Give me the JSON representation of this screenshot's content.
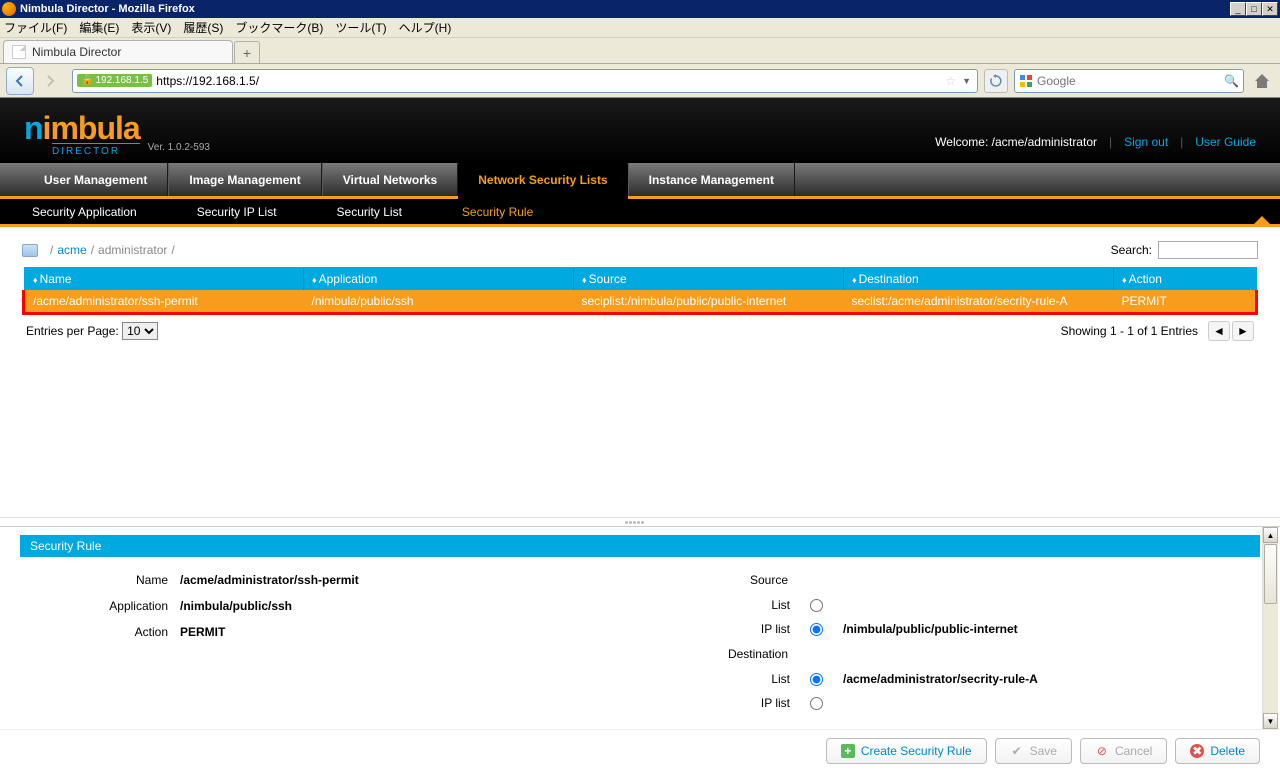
{
  "window": {
    "title": "Nimbula Director - Mozilla Firefox"
  },
  "menubar": {
    "file": "ファイル(F)",
    "edit": "編集(E)",
    "view": "表示(V)",
    "history": "履歴(S)",
    "bookmarks": "ブックマーク(B)",
    "tools": "ツール(T)",
    "help": "ヘルプ(H)"
  },
  "tabs": {
    "title": "Nimbula Director"
  },
  "nav": {
    "badge": "192.168.1.5",
    "url": "https://192.168.1.5/",
    "search_placeholder": "Google"
  },
  "header": {
    "version": "Ver. 1.0.2-593",
    "welcome": "Welcome: /acme/administrator",
    "signout": "Sign out",
    "userguide": "User Guide"
  },
  "mainnav": {
    "user": "User Management",
    "image": "Image Management",
    "virtual": "Virtual Networks",
    "network": "Network Security Lists",
    "instance": "Instance Management"
  },
  "subnav": {
    "app": "Security Application",
    "iplist": "Security IP List",
    "seclist": "Security List",
    "rule": "Security Rule"
  },
  "breadcrumb": {
    "acme": "acme",
    "admin": "administrator",
    "search_label": "Search:"
  },
  "table": {
    "headers": {
      "name": "Name",
      "app": "Application",
      "src": "Source",
      "dst": "Destination",
      "action": "Action"
    },
    "rows": [
      {
        "name": "/acme/administrator/ssh-permit",
        "app": "/nimbula/public/ssh",
        "src": "seciplist:/nimbula/public/public-internet",
        "dst": "seclist:/acme/administrator/secrity-rule-A",
        "action": "PERMIT"
      }
    ]
  },
  "pager": {
    "label": "Entries per Page:",
    "value": "10",
    "info": "Showing 1 - 1 of 1 Entries"
  },
  "detail": {
    "panel_title": "Security Rule",
    "name_label": "Name",
    "name_value": "/acme/administrator/ssh-permit",
    "app_label": "Application",
    "app_value": "/nimbula/public/ssh",
    "action_label": "Action",
    "action_value": "PERMIT",
    "source_label": "Source",
    "dest_label": "Destination",
    "list_label": "List",
    "iplist_label": "IP list",
    "src_iplist_value": "/nimbula/public/public-internet",
    "dst_list_value": "/acme/administrator/secrity-rule-A"
  },
  "buttons": {
    "create": "Create Security Rule",
    "save": "Save",
    "cancel": "Cancel",
    "delete": "Delete"
  }
}
